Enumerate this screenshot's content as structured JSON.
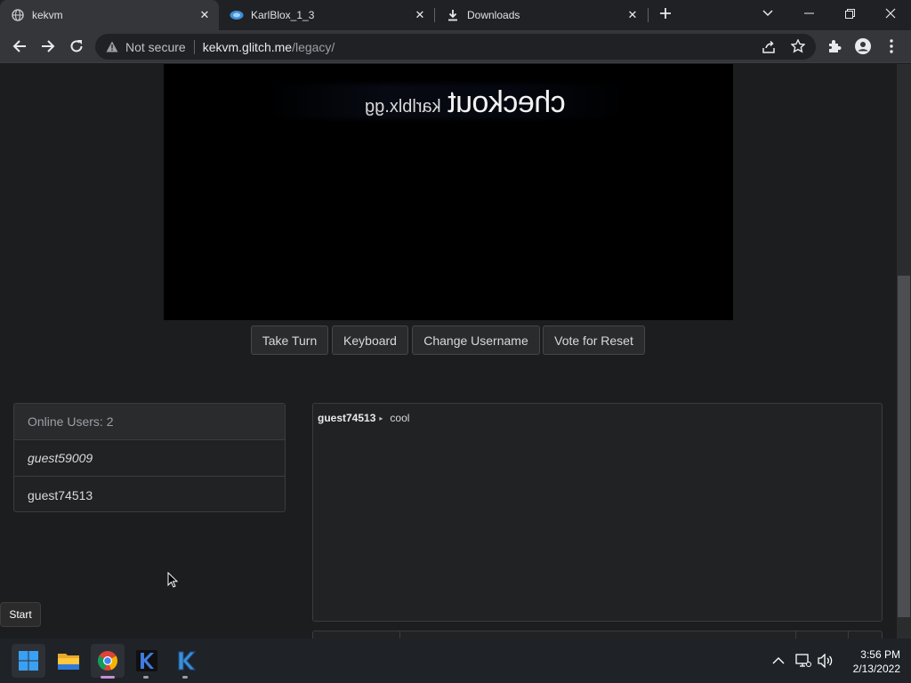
{
  "browser": {
    "tabs": [
      {
        "label": "kekvm",
        "icon": "globe-icon",
        "active": true
      },
      {
        "label": "KarlBlox_1_3",
        "icon": "karlblox-icon",
        "active": false
      },
      {
        "label": "Downloads",
        "icon": "download-icon",
        "active": false
      }
    ],
    "security_label": "Not secure",
    "url_host": "kekvm.glitch.me",
    "url_path": "/legacy/"
  },
  "vm": {
    "screen_text_main": "checkout",
    "screen_text_sub": "karlblx.gg",
    "buttons": {
      "take_turn": "Take Turn",
      "keyboard": "Keyboard",
      "change_username": "Change Username",
      "vote_reset": "Vote for Reset"
    }
  },
  "users": {
    "header": "Online Users: 2",
    "list": [
      "guest59009",
      "guest74513"
    ]
  },
  "chat": {
    "messages": [
      {
        "user": "guest74513",
        "text": "cool"
      }
    ]
  },
  "taskbar": {
    "tooltip": "Start",
    "time": "3:56 PM",
    "date": "2/13/2022"
  },
  "colors": {
    "page_bg": "#1c1d1f",
    "tab_bar": "#202124",
    "toolbar": "#35363a",
    "panel": "#212224",
    "taskbar": "#1f2328"
  }
}
